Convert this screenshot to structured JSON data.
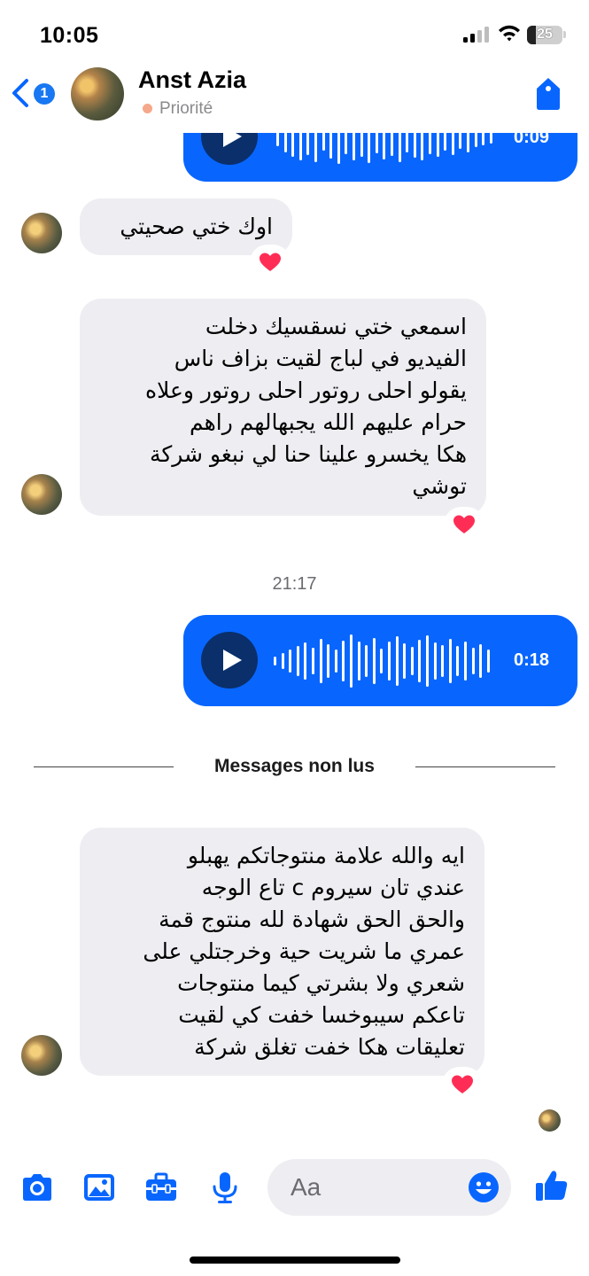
{
  "status_bar": {
    "time": "10:05",
    "battery": "25"
  },
  "header": {
    "back_count": "1",
    "contact_name": "Anst Azia",
    "priority_label": "Priorité"
  },
  "messages": {
    "voice_top_duration": "0:09",
    "incoming_1": "اوك ختي صحيتي",
    "incoming_2": [
      "اسمعي ختي نسقسيك دخلت",
      "الفيديو في لباج لقيت بزاف ناس",
      "يقولو احلى روتور احلى روتور وعلاه",
      "حرام عليهم الله يجبهالهم راهم",
      "هكا يخسرو علينا حنا لي نبغو شركة",
      "توشي"
    ],
    "timestamp": "21:17",
    "voice_sent_duration": "0:18",
    "unread_divider": "Messages non lus",
    "incoming_3": [
      "ايه والله علامة منتوجاتكم يهبلو",
      "عندي تان سيروم c تاع الوجه",
      "والحق الحق شهادة لله منتوج قمة",
      "عمري ما شريت حية وخرجتلي على",
      "شعري ولا بشرتي كيما منتوجات",
      "تاعكم سيبوخسا خفت كي لقيت",
      "تعليقات هكا خفت تغلق شركة"
    ],
    "reaction": "❤️"
  },
  "composer": {
    "placeholder": "Aa"
  },
  "colors": {
    "accent": "#0866ff",
    "bubble_in": "#eeeef2",
    "heart": "#ff2d55"
  },
  "icons": [
    "back-chevron-icon",
    "tag-icon",
    "play-icon",
    "heart-icon",
    "camera-icon",
    "image-icon",
    "toolbox-icon",
    "microphone-icon",
    "emoji-icon",
    "thumbs-up-icon"
  ]
}
